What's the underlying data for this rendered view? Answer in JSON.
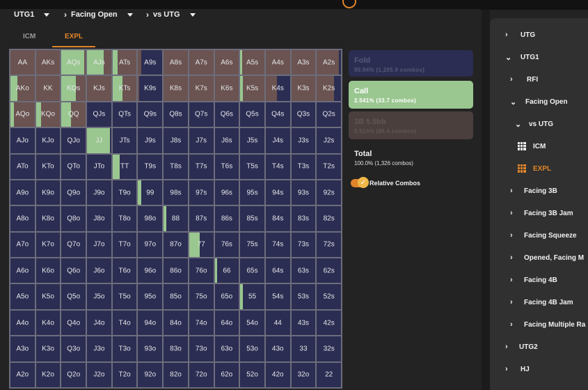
{
  "colors": {
    "accent": "#e0852a",
    "fold": "#2b2d52",
    "call": "#9ac790",
    "raise": "#6a5350"
  },
  "breadcrumb": [
    {
      "label": "UTG1",
      "icon": "dropdown-triangle-icon"
    },
    {
      "label": "Facing Open",
      "icon": "dropdown-triangle-icon"
    },
    {
      "label": "vs UTG",
      "icon": "dropdown-triangle-icon"
    }
  ],
  "tabs": {
    "icm": "ICM",
    "expl": "EXPL"
  },
  "legend": {
    "fold": {
      "title": "Fold",
      "detail": "90.94% (1,205.9 combos)"
    },
    "call": {
      "title": "Call",
      "detail": "2.541% (33.7 combos)"
    },
    "sbb": {
      "title": "3B 5.5bb",
      "detail": "6.514% (86.4 combos)"
    },
    "total": {
      "title": "Total",
      "detail": "100.0% (1,326 combos)"
    },
    "relative_combos": "Relative Combos"
  },
  "hands": [
    [
      "AA",
      "AKs",
      "AQs",
      "AJs",
      "ATs",
      "A9s",
      "A8s",
      "A7s",
      "A6s",
      "A5s",
      "A4s",
      "A3s",
      "A2s"
    ],
    [
      "AKo",
      "KK",
      "KQs",
      "KJs",
      "KTs",
      "K9s",
      "K8s",
      "K7s",
      "K6s",
      "K5s",
      "K4s",
      "K3s",
      "K2s"
    ],
    [
      "AQo",
      "KQo",
      "QQ",
      "QJs",
      "QTs",
      "Q9s",
      "Q8s",
      "Q7s",
      "Q6s",
      "Q5s",
      "Q4s",
      "Q3s",
      "Q2s"
    ],
    [
      "AJo",
      "KJo",
      "QJo",
      "JJ",
      "JTs",
      "J9s",
      "J8s",
      "J7s",
      "J6s",
      "J5s",
      "J4s",
      "J3s",
      "J2s"
    ],
    [
      "ATo",
      "KTo",
      "QTo",
      "JTo",
      "TT",
      "T9s",
      "T8s",
      "T7s",
      "T6s",
      "T5s",
      "T4s",
      "T3s",
      "T2s"
    ],
    [
      "A9o",
      "K9o",
      "Q9o",
      "J9o",
      "T9o",
      "99",
      "98s",
      "97s",
      "96s",
      "95s",
      "94s",
      "93s",
      "92s"
    ],
    [
      "A8o",
      "K8o",
      "Q8o",
      "J8o",
      "T8o",
      "98o",
      "88",
      "87s",
      "86s",
      "85s",
      "84s",
      "83s",
      "82s"
    ],
    [
      "A7o",
      "K7o",
      "Q7o",
      "J7o",
      "T7o",
      "97o",
      "87o",
      "77",
      "76s",
      "75s",
      "74s",
      "73s",
      "72s"
    ],
    [
      "A6o",
      "K6o",
      "Q6o",
      "J6o",
      "T6o",
      "96o",
      "86o",
      "76o",
      "66",
      "65s",
      "64s",
      "63s",
      "62s"
    ],
    [
      "A5o",
      "K5o",
      "Q5o",
      "J5o",
      "T5o",
      "95o",
      "85o",
      "75o",
      "65o",
      "55",
      "54s",
      "53s",
      "52s"
    ],
    [
      "A4o",
      "K4o",
      "Q4o",
      "J4o",
      "T4o",
      "94o",
      "84o",
      "74o",
      "64o",
      "54o",
      "44",
      "43s",
      "42s"
    ],
    [
      "A3o",
      "K3o",
      "Q3o",
      "J3o",
      "T3o",
      "93o",
      "83o",
      "73o",
      "63o",
      "53o",
      "43o",
      "33",
      "32s"
    ],
    [
      "A2o",
      "K2o",
      "Q2o",
      "J2o",
      "T2o",
      "92o",
      "82o",
      "72o",
      "62o",
      "52o",
      "42o",
      "32o",
      "22"
    ]
  ],
  "strategy": {
    "AA": {
      "raise": 1.0
    },
    "AKs": {
      "raise": 1.0
    },
    "AQs": {
      "call": 0.95,
      "raise": 0.05
    },
    "AJs": {
      "call": 0.7,
      "raise": 0.3
    },
    "ATs": {
      "call": 0.2,
      "raise": 0.8
    },
    "A9s": {
      "raise": 0.12
    },
    "A8s": {
      "raise": 1.0
    },
    "A7s": {
      "raise": 1.0
    },
    "A6s": {
      "raise": 1.0
    },
    "A5s": {
      "call": 0.08,
      "raise": 0.92
    },
    "A4s": {
      "raise": 1.0
    },
    "A3s": {
      "raise": 1.0
    },
    "A2s": {
      "raise": 0.9
    },
    "AKo": {
      "call": 0.3,
      "raise": 0.7
    },
    "KK": {
      "raise": 1.0
    },
    "KQs": {
      "call": 0.6,
      "raise": 0.4
    },
    "KJs": {
      "raise": 1.0
    },
    "KTs": {
      "call": 0.4,
      "raise": 0.6
    },
    "K9s": {
      "raise": 0.05
    },
    "K8s": {
      "raise": 1.0
    },
    "K7s": {
      "raise": 1.0
    },
    "K6s": {
      "raise": 1.0
    },
    "K5s": {
      "call": 0.1,
      "raise": 0.9
    },
    "K4s": {
      "raise": 0.45
    },
    "K3s": {
      "raise": 1.0
    },
    "K2s": {
      "raise": 0.7
    },
    "AQo": {
      "call": 0.15,
      "raise": 0.85
    },
    "KQo": {
      "call": 0.2,
      "raise": 0.8
    },
    "QQ": {
      "call": 0.4,
      "raise": 0.6
    },
    "JJ": {
      "call": 0.95
    },
    "TT": {
      "call": 0.3
    },
    "99": {
      "call": 0.12
    },
    "88": {
      "call": 0.1
    },
    "77": {
      "call": 0.45
    },
    "66": {
      "call": 0.1
    },
    "55": {
      "call": 0.1
    }
  },
  "sidebar": [
    {
      "label": "UTG",
      "icon": "chevron-right-icon"
    },
    {
      "label": "UTG1",
      "icon": "chevron-down-icon"
    },
    {
      "label": "RFI",
      "icon": "chevron-right-icon"
    },
    {
      "label": "Facing Open",
      "icon": "chevron-down-icon"
    },
    {
      "label": "vs UTG",
      "icon": "chevron-down-icon"
    },
    {
      "label": "ICM",
      "icon": "grid-icon"
    },
    {
      "label": "EXPL",
      "icon": "grid-icon"
    },
    {
      "label": "Facing 3B",
      "icon": "chevron-right-icon"
    },
    {
      "label": "Facing 3B Jam",
      "icon": "chevron-right-icon"
    },
    {
      "label": "Facing Squeeze",
      "icon": "chevron-right-icon"
    },
    {
      "label": "Opened, Facing M",
      "icon": "chevron-right-icon"
    },
    {
      "label": "Facing 4B",
      "icon": "chevron-right-icon"
    },
    {
      "label": "Facing 4B Jam",
      "icon": "chevron-right-icon"
    },
    {
      "label": "Facing Multiple Ra",
      "icon": "chevron-right-icon"
    },
    {
      "label": "UTG2",
      "icon": "chevron-right-icon"
    },
    {
      "label": "HJ",
      "icon": "chevron-right-icon"
    }
  ]
}
